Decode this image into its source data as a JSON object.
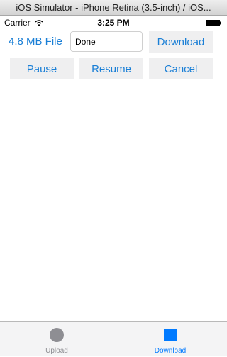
{
  "window": {
    "title": "iOS Simulator - iPhone Retina (3.5-inch) / iOS..."
  },
  "status_bar": {
    "carrier": "Carrier",
    "time": "3:25 PM",
    "icons": [
      "wifi-icon",
      "battery-icon"
    ]
  },
  "transfer": {
    "file_label": "4.8 MB File",
    "status_value": "Done",
    "download_label": "Download",
    "pause_label": "Pause",
    "resume_label": "Resume",
    "cancel_label": "Cancel"
  },
  "tab_bar": {
    "tabs": [
      {
        "label": "Upload",
        "icon": "circle-icon",
        "selected": false
      },
      {
        "label": "Download",
        "icon": "square-icon",
        "selected": true
      }
    ]
  },
  "colors": {
    "accent": "#1a7fd6",
    "button_background": "#efeff0",
    "tab_inactive": "#8e8e93",
    "tab_active": "#007aff"
  }
}
